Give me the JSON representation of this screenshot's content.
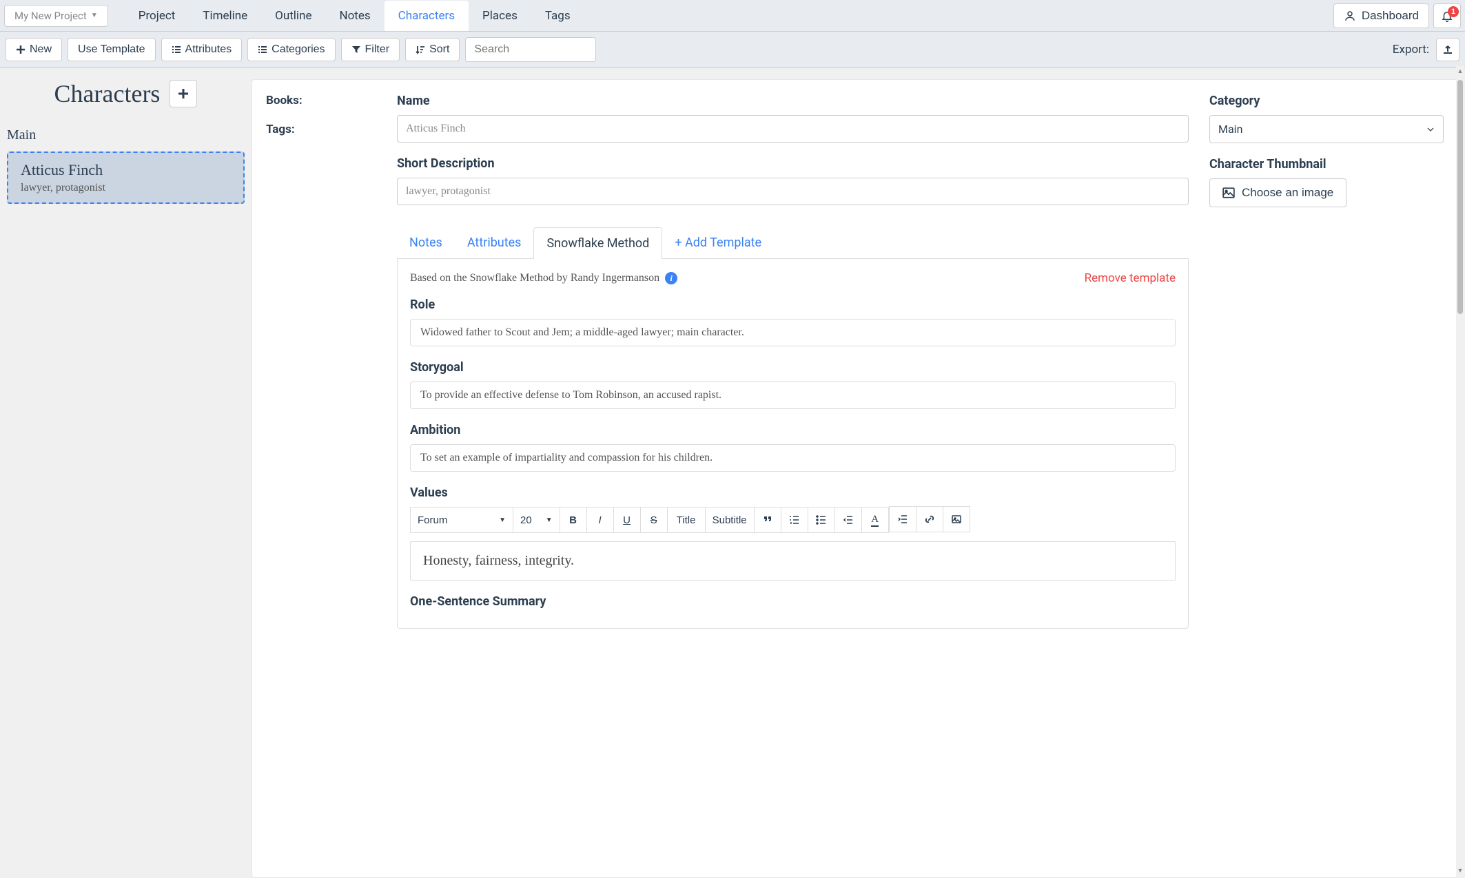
{
  "project_dropdown": "My New Project",
  "nav": {
    "project": "Project",
    "timeline": "Timeline",
    "outline": "Outline",
    "notes": "Notes",
    "characters": "Characters",
    "places": "Places",
    "tags": "Tags"
  },
  "dashboard": "Dashboard",
  "notif_count": "1",
  "toolbar": {
    "new": "New",
    "use_template": "Use Template",
    "attributes": "Attributes",
    "categories": "Categories",
    "filter": "Filter",
    "sort": "Sort",
    "search_placeholder": "Search",
    "export": "Export:"
  },
  "sidebar": {
    "title": "Characters",
    "category": "Main",
    "char_name": "Atticus Finch",
    "char_desc": "lawyer, protagonist"
  },
  "meta": {
    "books": "Books:",
    "tags": "Tags:"
  },
  "form": {
    "name_label": "Name",
    "name_value": "Atticus Finch",
    "short_desc_label": "Short Description",
    "short_desc_value": "lawyer, protagonist",
    "category_label": "Category",
    "category_value": "Main",
    "thumbnail_label": "Character Thumbnail",
    "choose_image": "Choose an image"
  },
  "tabs": {
    "notes": "Notes",
    "attributes": "Attributes",
    "snowflake": "Snowflake Method",
    "add": "+ Add Template"
  },
  "snowflake": {
    "intro": "Based on the Snowflake Method by Randy Ingermanson",
    "remove": "Remove template",
    "role_label": "Role",
    "role_value": "Widowed father to Scout and Jem; a middle-aged lawyer; main character.",
    "storygoal_label": "Storygoal",
    "storygoal_value": "To provide an effective defense to Tom Robinson, an accused rapist.",
    "ambition_label": "Ambition",
    "ambition_value": "To set an example of impartiality and compassion for his children.",
    "values_label": "Values",
    "values_text": "Honesty, fairness, integrity.",
    "summary_label": "One-Sentence Summary"
  },
  "rte": {
    "font": "Forum",
    "size": "20",
    "title": "Title",
    "subtitle": "Subtitle"
  }
}
